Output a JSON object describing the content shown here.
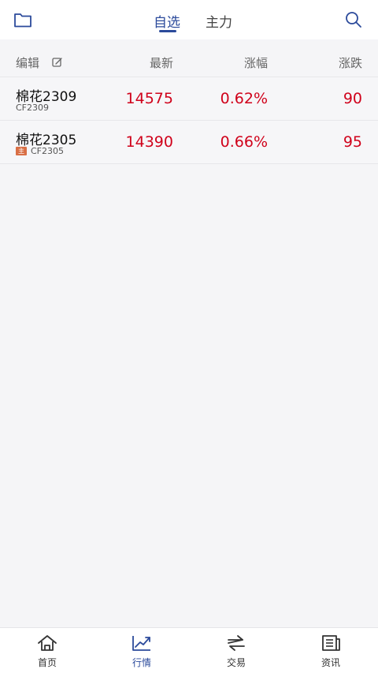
{
  "topbar": {
    "tabs": [
      {
        "label": "自选",
        "active": true
      },
      {
        "label": "主力",
        "active": false
      }
    ],
    "left_icon": "folder-icon",
    "right_icon": "search-icon"
  },
  "table": {
    "headers": {
      "edit": "编辑",
      "latest": "最新",
      "pct": "涨幅",
      "chg": "涨跌"
    },
    "rows": [
      {
        "name": "棉花2309",
        "code": "CF2309",
        "badge": "",
        "latest": "14575",
        "pct": "0.62%",
        "chg": "90"
      },
      {
        "name": "棉花2305",
        "code": "CF2305",
        "badge": "主",
        "latest": "14390",
        "pct": "0.66%",
        "chg": "95"
      }
    ]
  },
  "bottom_nav": [
    {
      "label": "首页",
      "icon": "home-icon",
      "active": false
    },
    {
      "label": "行情",
      "icon": "market-chart-icon",
      "active": true
    },
    {
      "label": "交易",
      "icon": "trade-icon",
      "active": false
    },
    {
      "label": "资讯",
      "icon": "news-icon",
      "active": false
    }
  ],
  "colors": {
    "accent": "#2b4a9b",
    "up": "#d0021b",
    "badge": "#d96f45"
  }
}
